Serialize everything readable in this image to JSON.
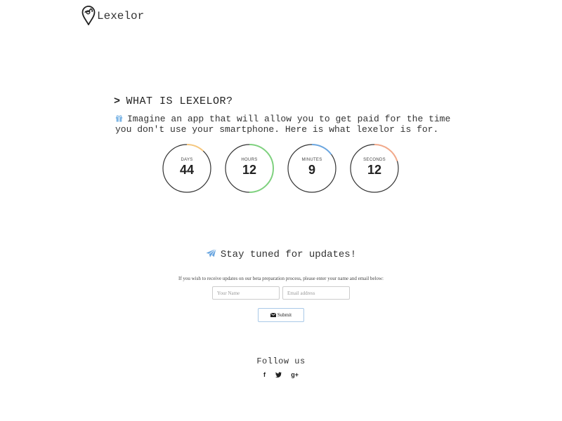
{
  "brand": {
    "name": "Lexelor"
  },
  "about": {
    "title": "WHAT IS LEXELOR?",
    "description": "Imagine an app that will allow you to get paid for the time you don't use your smartphone. Here is what lexelor is for."
  },
  "countdown": [
    {
      "unit": "DAYS",
      "value": "44",
      "progress": 0.12,
      "color": "#f5c77e"
    },
    {
      "unit": "HOURS",
      "value": "12",
      "progress": 0.5,
      "color": "#7fd17f"
    },
    {
      "unit": "MINUTES",
      "value": "9",
      "progress": 0.15,
      "color": "#6aa6e0"
    },
    {
      "unit": "SECONDS",
      "value": "12",
      "progress": 0.2,
      "color": "#f2a98a"
    }
  ],
  "signup": {
    "headline": "Stay tuned for updates!",
    "text": "If you wish to receive updates on our beta preparation process, please enter your name and email below:",
    "name_placeholder": "Your Name",
    "email_placeholder": "Email address",
    "submit_label": "Submit"
  },
  "footer": {
    "follow_label": "Follow us",
    "social": [
      {
        "label": "f",
        "icon": "facebook-icon"
      },
      {
        "label": "t",
        "icon": "twitter-icon"
      },
      {
        "label": "g+",
        "icon": "google-plus-icon"
      }
    ]
  },
  "colors": {
    "accent": "#6aa6e0",
    "gift": "#7fb7e6",
    "ring": "#333333"
  }
}
